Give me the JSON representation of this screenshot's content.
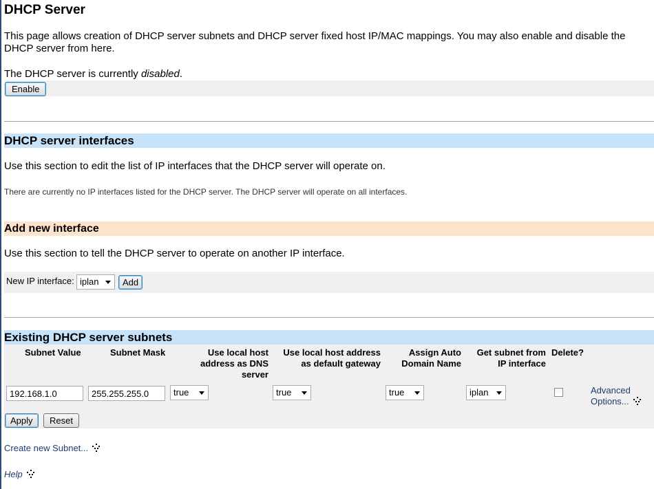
{
  "title": "DHCP Server",
  "intro": "This page allows creation of DHCP server subnets and DHCP server fixed host IP/MAC mappings. You may also enable and disable the DHCP server from here.",
  "status": {
    "prefix": "The DHCP server is currently ",
    "state": "disabled",
    "suffix": "."
  },
  "enable_button": "Enable",
  "interfaces": {
    "heading": "DHCP server interfaces",
    "description": "Use this section to edit the list of IP interfaces that the DHCP server will operate on.",
    "note": "There are currently no IP interfaces listed for the DHCP server. The DHCP server will operate on all interfaces."
  },
  "add_interface": {
    "heading": "Add new interface",
    "description": "Use this section to tell the DHCP server to operate on another IP interface.",
    "label": "New IP interface:",
    "selected": "iplan",
    "add_button": "Add"
  },
  "subnets": {
    "heading": "Existing DHCP server subnets",
    "columns": {
      "subnet_value": "Subnet Value",
      "subnet_mask": "Subnet Mask",
      "dns_1": "Use local host",
      "dns_2": "address as DNS",
      "dns_3": "server",
      "gw_1": "Use local host address",
      "gw_2": "as default gateway",
      "auto_1": "Assign Auto",
      "auto_2": "Domain Name",
      "iface_1": "Get subnet from",
      "iface_2": "IP interface",
      "delete": "Delete?"
    },
    "row": {
      "subnet_value": "192.168.1.0",
      "subnet_mask": "255.255.255.0",
      "dns": "true",
      "gateway": "true",
      "auto_domain": "true",
      "interface": "iplan",
      "advanced_1": "Advanced",
      "advanced_2": "Options..."
    },
    "apply_button": "Apply",
    "reset_button": "Reset"
  },
  "create_subnet_link": "Create new Subnet...",
  "help_link": "Help"
}
